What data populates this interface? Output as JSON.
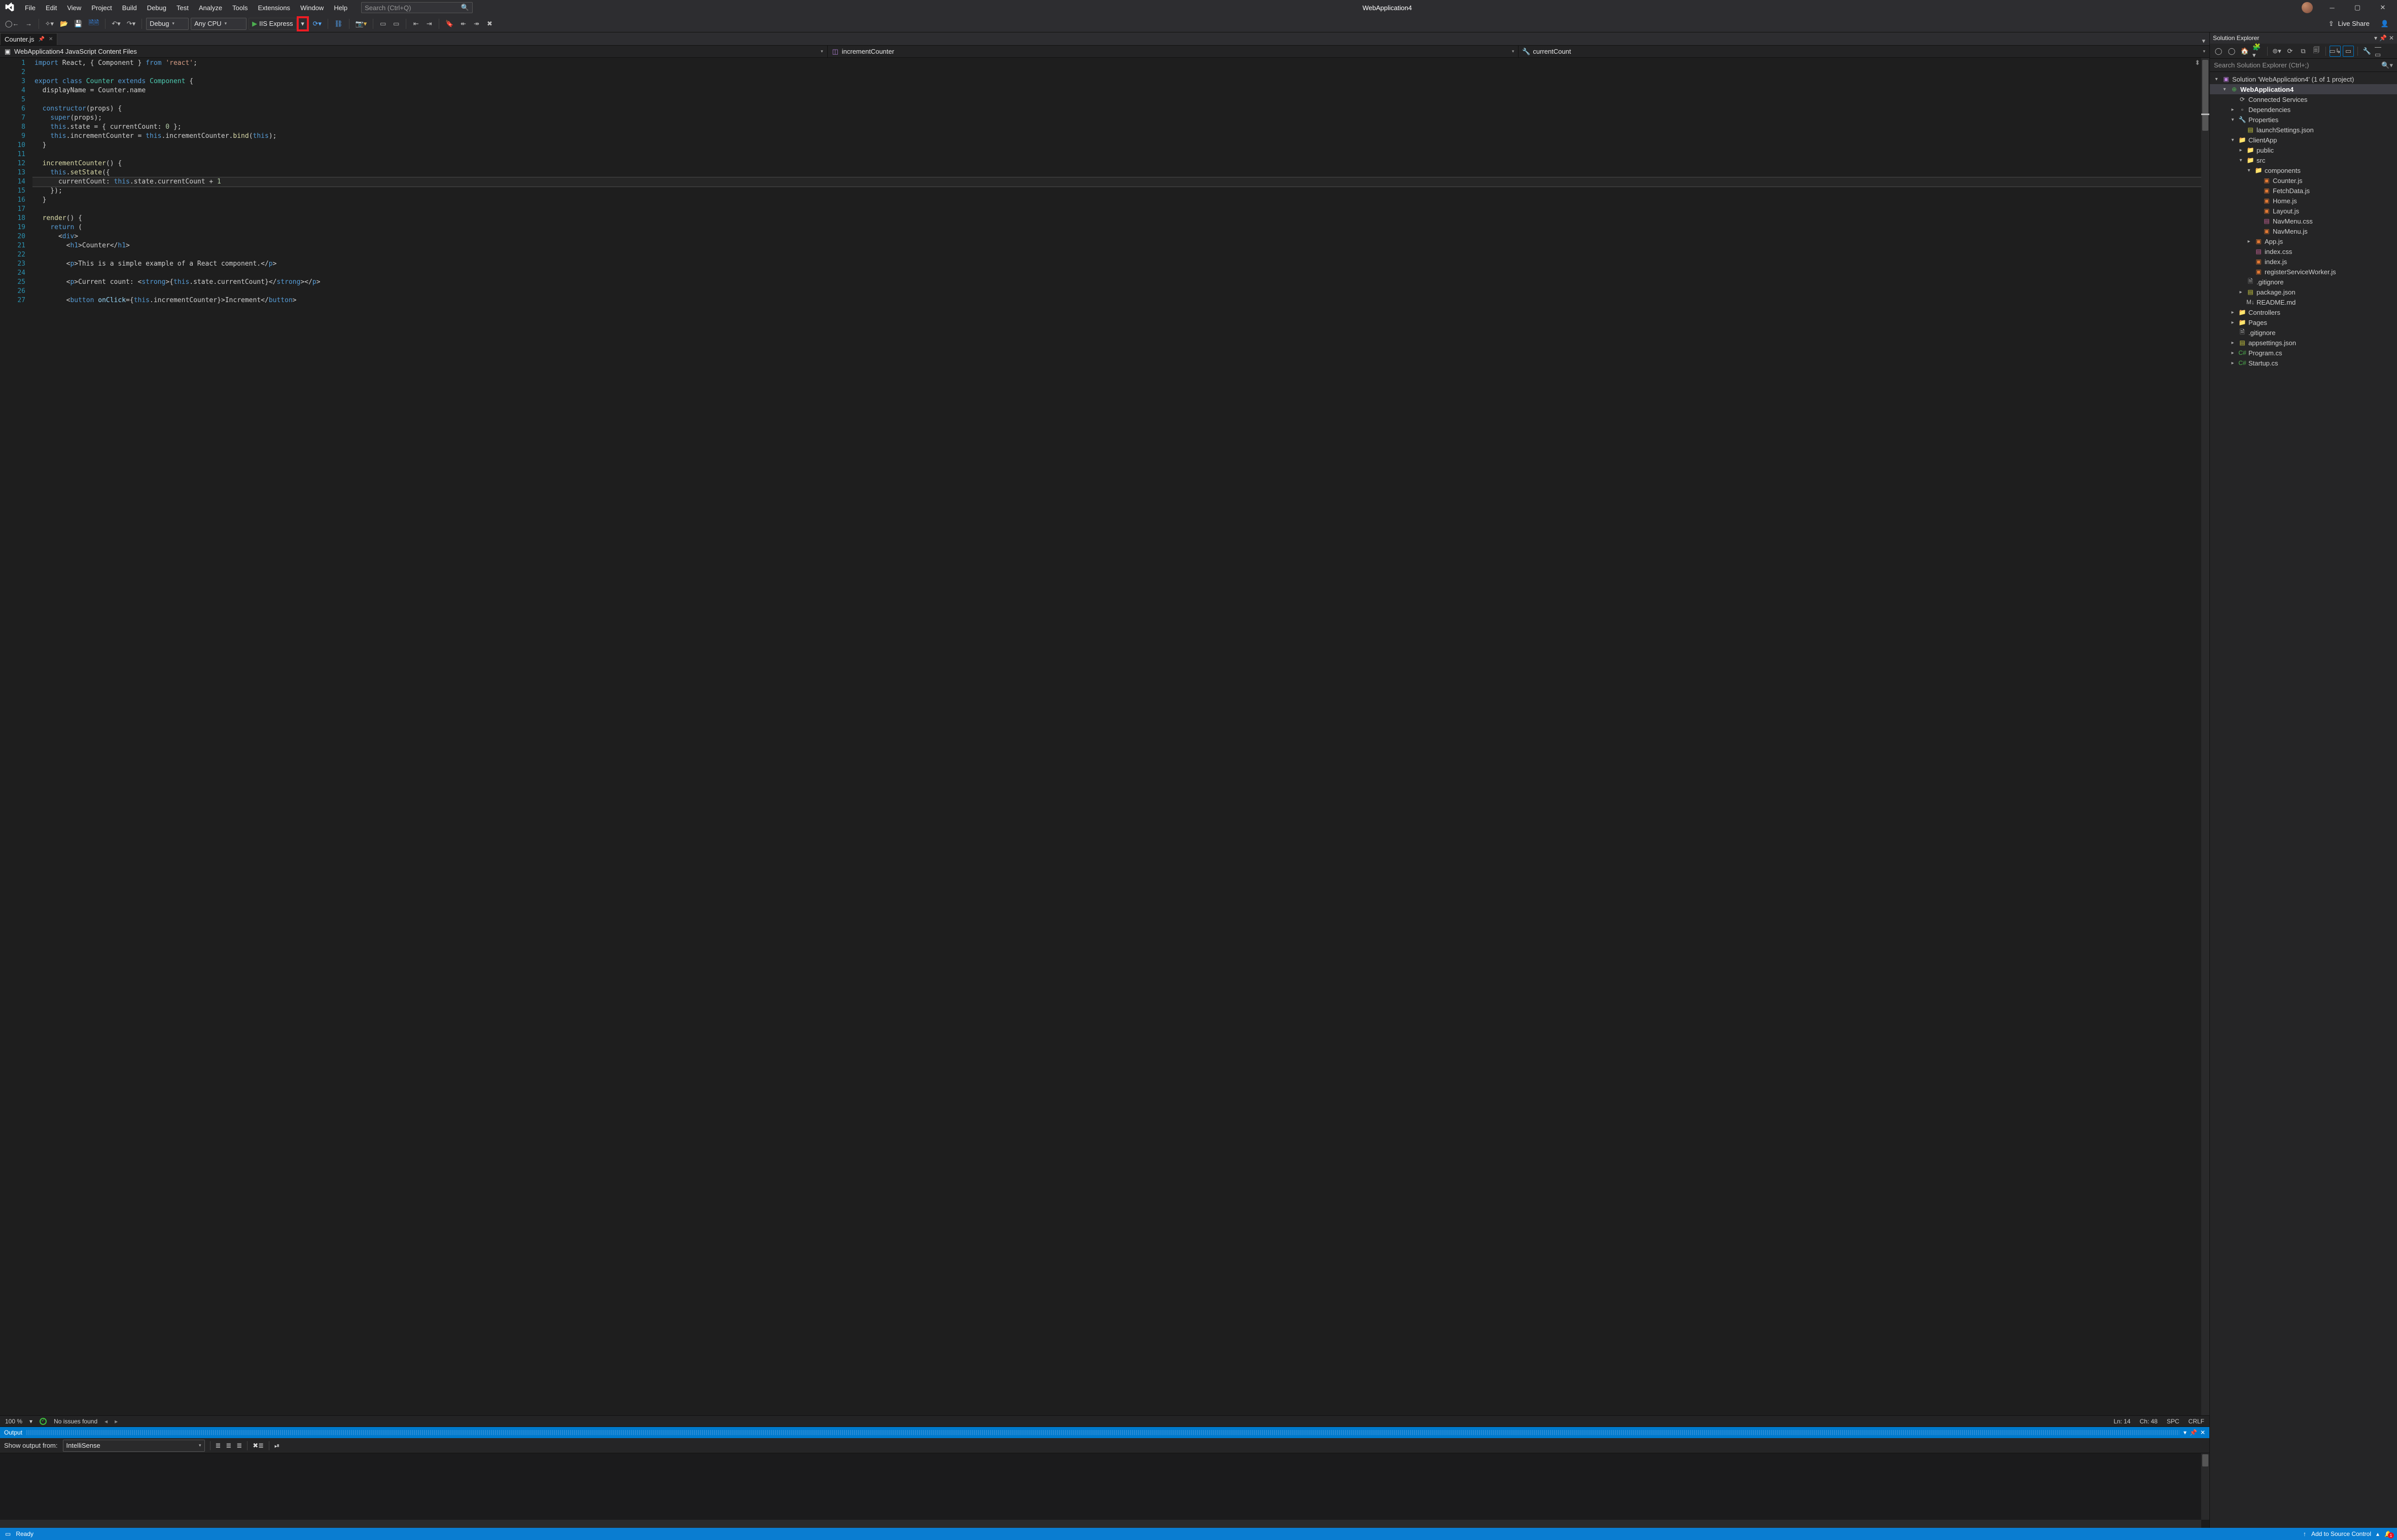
{
  "app": {
    "title": "WebApplication4",
    "search_placeholder": "Search (Ctrl+Q)"
  },
  "menubar": {
    "items": [
      "File",
      "Edit",
      "View",
      "Project",
      "Build",
      "Debug",
      "Test",
      "Analyze",
      "Tools",
      "Extensions",
      "Window",
      "Help"
    ]
  },
  "toolbar": {
    "config": "Debug",
    "platform": "Any CPU",
    "run_target": "IIS Express",
    "live_share": "Live Share"
  },
  "doctab": {
    "name": "Counter.js"
  },
  "navbar": {
    "scope": "WebApplication4 JavaScript Content Files",
    "type": "incrementCounter",
    "member": "currentCount"
  },
  "editor": {
    "zoom": "100 %",
    "issues": "No issues found",
    "line": "Ln: 14",
    "col": "Ch: 48",
    "ins": "SPC",
    "eol": "CRLF",
    "active_line": 14,
    "lines": [
      {
        "n": 1,
        "html": "<span class='kw'>import</span> <span class='pl'>React, { Component }</span> <span class='kw'>from</span> <span class='str'>'react'</span>;"
      },
      {
        "n": 2,
        "html": ""
      },
      {
        "n": 3,
        "fold": "⊟",
        "html": "<span class='kw'>export</span> <span class='kw'>class</span> <span class='cls'>Counter</span> <span class='kw'>extends</span> <span class='cls'>Component</span> {"
      },
      {
        "n": 4,
        "html": "  displayName = Counter.name"
      },
      {
        "n": 5,
        "html": ""
      },
      {
        "n": 6,
        "fold": "⊟",
        "html": "  <span class='kw'>constructor</span>(props) {"
      },
      {
        "n": 7,
        "html": "    <span class='kw'>super</span>(props);"
      },
      {
        "n": 8,
        "html": "    <span class='kw'>this</span>.state = { currentCount: <span class='num'>0</span> };"
      },
      {
        "n": 9,
        "html": "    <span class='kw'>this</span>.incrementCounter = <span class='kw'>this</span>.incrementCounter.<span class='mtd'>bind</span>(<span class='kw'>this</span>);"
      },
      {
        "n": 10,
        "html": "  }"
      },
      {
        "n": 11,
        "html": ""
      },
      {
        "n": 12,
        "fold": "⊟",
        "html": "  <span class='mtd'>incrementCounter</span>() {"
      },
      {
        "n": 13,
        "fold": "⊟",
        "html": "    <span class='kw'>this</span>.<span class='mtd'>setState</span>({"
      },
      {
        "n": 14,
        "html": "      currentCount: <span class='kw'>this</span>.state.currentCount + <span class='num'>1</span>"
      },
      {
        "n": 15,
        "html": "    });"
      },
      {
        "n": 16,
        "html": "  }"
      },
      {
        "n": 17,
        "html": ""
      },
      {
        "n": 18,
        "fold": "⊟",
        "html": "  <span class='mtd'>render</span>() {"
      },
      {
        "n": 19,
        "html": "    <span class='kw'>return</span> ("
      },
      {
        "n": 20,
        "fold": "⊟",
        "html": "      &lt;<span class='tag'>div</span>&gt;"
      },
      {
        "n": 21,
        "html": "        &lt;<span class='tag'>h1</span>&gt;Counter&lt;/<span class='tag'>h1</span>&gt;"
      },
      {
        "n": 22,
        "html": ""
      },
      {
        "n": 23,
        "html": "        &lt;<span class='tag'>p</span>&gt;This is a simple example of a React component.&lt;/<span class='tag'>p</span>&gt;"
      },
      {
        "n": 24,
        "html": ""
      },
      {
        "n": 25,
        "html": "        &lt;<span class='tag'>p</span>&gt;Current count: &lt;<span class='tag'>strong</span>&gt;{<span class='kw'>this</span>.state.currentCount}&lt;/<span class='tag'>strong</span>&gt;&lt;/<span class='tag'>p</span>&gt;"
      },
      {
        "n": 26,
        "html": ""
      },
      {
        "n": 27,
        "html": "        &lt;<span class='tag'>button</span> <span class='attr'>onClick</span>={<span class='kw'>this</span>.incrementCounter}&gt;Increment&lt;/<span class='tag'>button</span>&gt;"
      }
    ]
  },
  "output": {
    "title": "Output",
    "show_from_label": "Show output from:",
    "source": "IntelliSense"
  },
  "sol": {
    "title": "Solution Explorer",
    "search_placeholder": "Search Solution Explorer (Ctrl+;)",
    "root": "Solution 'WebApplication4' (1 of 1 project)",
    "nodes": [
      {
        "d": 0,
        "tw": "▾",
        "ic": "ic-sol",
        "g": "▣",
        "t": "Solution 'WebApplication4' (1 of 1 project)"
      },
      {
        "d": 1,
        "tw": "▾",
        "ic": "ic-proj",
        "g": "⊕",
        "t": "WebApplication4",
        "sel": true,
        "bold": true
      },
      {
        "d": 2,
        "tw": "",
        "ic": "ic-dep",
        "g": "⟳",
        "t": "Connected Services"
      },
      {
        "d": 2,
        "tw": "▸",
        "ic": "ic-dep",
        "g": "▫",
        "t": "Dependencies"
      },
      {
        "d": 2,
        "tw": "▾",
        "ic": "ic-wrench",
        "g": "🔧",
        "t": "Properties"
      },
      {
        "d": 3,
        "tw": "",
        "ic": "ic-json",
        "g": "▤",
        "t": "launchSettings.json"
      },
      {
        "d": 2,
        "tw": "▾",
        "ic": "ic-fold",
        "g": "📁",
        "t": "ClientApp"
      },
      {
        "d": 3,
        "tw": "▸",
        "ic": "ic-fold",
        "g": "📁",
        "t": "public"
      },
      {
        "d": 3,
        "tw": "▾",
        "ic": "ic-fold",
        "g": "📁",
        "t": "src"
      },
      {
        "d": 4,
        "tw": "▾",
        "ic": "ic-fold",
        "g": "📁",
        "t": "components"
      },
      {
        "d": 5,
        "tw": "",
        "ic": "ic-js",
        "g": "▣",
        "t": "Counter.js"
      },
      {
        "d": 5,
        "tw": "",
        "ic": "ic-js",
        "g": "▣",
        "t": "FetchData.js"
      },
      {
        "d": 5,
        "tw": "",
        "ic": "ic-js",
        "g": "▣",
        "t": "Home.js"
      },
      {
        "d": 5,
        "tw": "",
        "ic": "ic-js",
        "g": "▣",
        "t": "Layout.js"
      },
      {
        "d": 5,
        "tw": "",
        "ic": "ic-css",
        "g": "▤",
        "t": "NavMenu.css"
      },
      {
        "d": 5,
        "tw": "",
        "ic": "ic-js",
        "g": "▣",
        "t": "NavMenu.js"
      },
      {
        "d": 4,
        "tw": "▸",
        "ic": "ic-js",
        "g": "▣",
        "t": "App.js"
      },
      {
        "d": 4,
        "tw": "",
        "ic": "ic-css",
        "g": "▤",
        "t": "index.css"
      },
      {
        "d": 4,
        "tw": "",
        "ic": "ic-js",
        "g": "▣",
        "t": "index.js"
      },
      {
        "d": 4,
        "tw": "",
        "ic": "ic-js",
        "g": "▣",
        "t": "registerServiceWorker.js"
      },
      {
        "d": 3,
        "tw": "",
        "ic": "ic-txt",
        "g": "🗎",
        "t": ".gitignore"
      },
      {
        "d": 3,
        "tw": "▸",
        "ic": "ic-json",
        "g": "▤",
        "t": "package.json"
      },
      {
        "d": 3,
        "tw": "",
        "ic": "ic-txt",
        "g": "M↓",
        "t": "README.md"
      },
      {
        "d": 2,
        "tw": "▸",
        "ic": "ic-fold",
        "g": "📁",
        "t": "Controllers"
      },
      {
        "d": 2,
        "tw": "▸",
        "ic": "ic-fold",
        "g": "📁",
        "t": "Pages"
      },
      {
        "d": 2,
        "tw": "",
        "ic": "ic-txt",
        "g": "🗎",
        "t": ".gitignore"
      },
      {
        "d": 2,
        "tw": "▸",
        "ic": "ic-json",
        "g": "▤",
        "t": "appsettings.json"
      },
      {
        "d": 2,
        "tw": "▸",
        "ic": "ic-cs",
        "g": "C#",
        "t": "Program.cs"
      },
      {
        "d": 2,
        "tw": "▸",
        "ic": "ic-cs",
        "g": "C#",
        "t": "Startup.cs"
      }
    ]
  },
  "statusbar": {
    "ready": "Ready",
    "add_sc": "Add to Source Control",
    "notifications": "1"
  }
}
